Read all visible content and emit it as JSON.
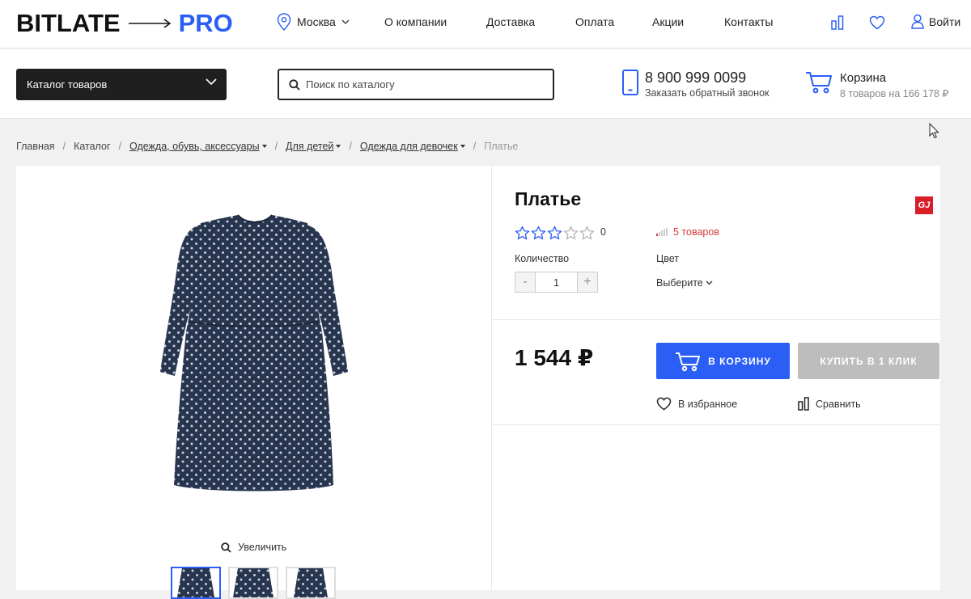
{
  "header": {
    "logo_main": "BITLATE",
    "logo_pro": "PRO",
    "city": "Москва",
    "nav": [
      "О компании",
      "Доставка",
      "Оплата",
      "Акции",
      "Контакты"
    ],
    "login": "Войти"
  },
  "subheader": {
    "catalog_button": "Каталог товаров",
    "search_placeholder": "Поиск по каталогу",
    "phone": "8 900 999 0099",
    "callback": "Заказать обратный звонок",
    "cart_title": "Корзина",
    "cart_summary": "8 товаров на 166 178 ₽"
  },
  "breadcrumb": {
    "home": "Главная",
    "catalog": "Каталог",
    "level1": "Одежда, обувь, аксессуары",
    "level2": "Для детей",
    "level3": "Одежда для девочек",
    "current": "Платье",
    "separator": "/"
  },
  "product": {
    "title": "Платье",
    "brand_badge": "GJ",
    "rating": 3,
    "rating_max": 5,
    "rating_count": "0",
    "stock": "5 товаров",
    "quantity_label": "Количество",
    "quantity_value": "1",
    "minus": "-",
    "plus": "+",
    "color_label": "Цвет",
    "color_select": "Выберите",
    "price": "1 544 ₽",
    "add_to_cart": "В КОРЗИНУ",
    "buy_one_click": "КУПИТЬ В 1 КЛИК",
    "favorite": "В избранное",
    "compare": "Сравнить",
    "zoom": "Увеличить"
  },
  "colors": {
    "accent": "#2b5ef5",
    "dark": "#1f1f1f",
    "stock_red": "#d23a3a",
    "disabled_button": "#bdbdbd",
    "brand_red": "#d91e2a",
    "dress": "#28354f"
  }
}
